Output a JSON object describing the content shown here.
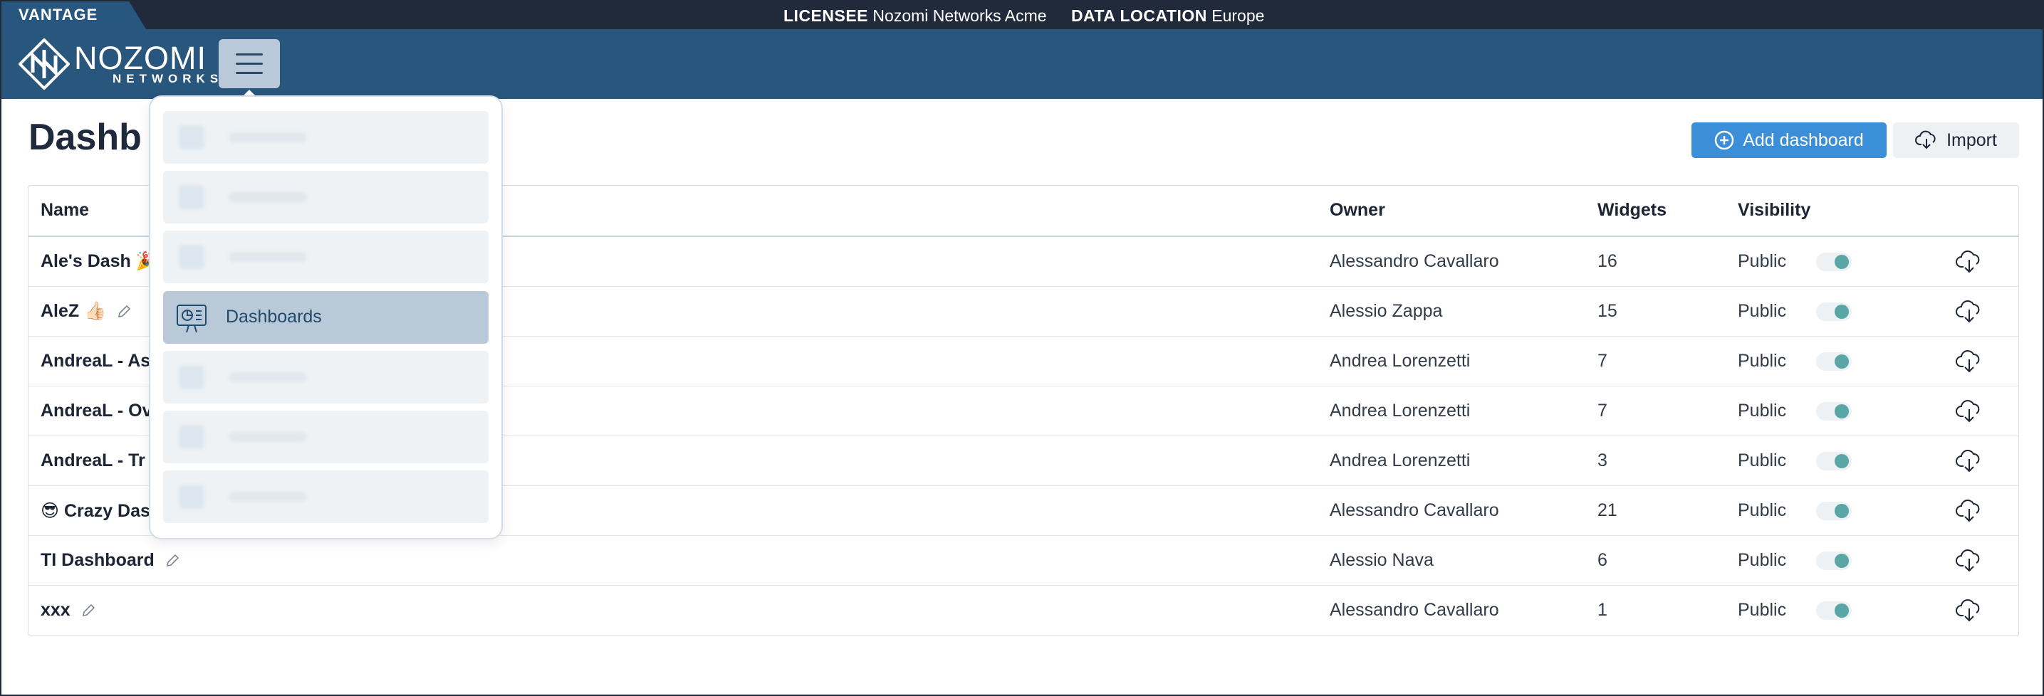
{
  "topbar": {
    "product": "VANTAGE",
    "licensee_label": "LICENSEE",
    "licensee_value": "Nozomi Networks Acme",
    "location_label": "DATA LOCATION",
    "location_value": "Europe"
  },
  "header": {
    "logo_main": "NOZOMI",
    "logo_sub": "NETWORKS",
    "menu_icon": "hamburger-icon"
  },
  "page": {
    "title": "Dashb",
    "add_button": "Add dashboard",
    "import_button": "Import"
  },
  "menu": {
    "active_item": "Dashboards",
    "blurred_items_count_visible": 6
  },
  "table": {
    "columns": [
      "Name",
      "Owner",
      "Widgets",
      "Visibility"
    ],
    "rows": [
      {
        "name": "Ale's Dash 🎉",
        "owner": "Alessandro Cavallaro",
        "widgets": "16",
        "visibility": "Public"
      },
      {
        "name": "AleZ 👍🏻",
        "owner": "Alessio Zappa",
        "widgets": "15",
        "visibility": "Public"
      },
      {
        "name": "AndreaL - As",
        "owner": "Andrea Lorenzetti",
        "widgets": "7",
        "visibility": "Public"
      },
      {
        "name": "AndreaL - Ov",
        "owner": "Andrea Lorenzetti",
        "widgets": "7",
        "visibility": "Public"
      },
      {
        "name": "AndreaL - Tr",
        "owner": "Andrea Lorenzetti",
        "widgets": "3",
        "visibility": "Public"
      },
      {
        "name": "😎 Crazy Das",
        "owner": "Alessandro Cavallaro",
        "widgets": "21",
        "visibility": "Public"
      },
      {
        "name": "TI Dashboard",
        "owner": "Alessio Nava",
        "widgets": "6",
        "visibility": "Public"
      },
      {
        "name": "xxx",
        "owner": "Alessandro Cavallaro",
        "widgets": "1",
        "visibility": "Public"
      }
    ]
  },
  "colors": {
    "topbar": "#212a3b",
    "header": "#29567d",
    "accent": "#3a8fd8",
    "toggle_on": "#5aa5a6"
  }
}
